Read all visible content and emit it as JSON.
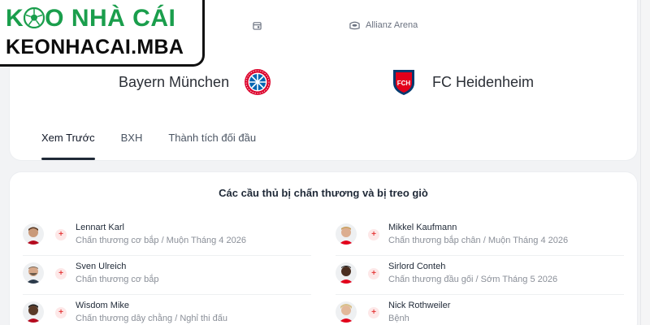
{
  "brand": {
    "line1_pre": "K",
    "line1_post": "O NHÀ CÁI",
    "line2": "KEONHACAI.MBA"
  },
  "match": {
    "venue": "Allianz Arena",
    "home_team": "Bayern München",
    "away_team": "FC Heidenheim",
    "home_crest_icon": "bayern-crest-icon",
    "away_crest_icon": "heidenheim-crest-icon"
  },
  "tabs": [
    {
      "label": "Xem Trước",
      "active": true
    },
    {
      "label": "BXH",
      "active": false
    },
    {
      "label": "Thành tích đối đầu",
      "active": false
    }
  ],
  "injuries": {
    "title": "Các cầu thủ bị chấn thương và bị treo giò",
    "home": [
      {
        "name": "Lennart Karl",
        "status": "Chấn thương cơ bắp / Muộn Tháng 4 2026"
      },
      {
        "name": "Sven Ulreich",
        "status": "Chấn thương cơ bắp"
      },
      {
        "name": "Wisdom Mike",
        "status": "Chấn thương dây chằng / Nghỉ thi đấu"
      }
    ],
    "away": [
      {
        "name": "Mikkel Kaufmann",
        "status": "Chấn thương bắp chân / Muộn Tháng 4 2026"
      },
      {
        "name": "Sirlord Conteh",
        "status": "Chấn thương đầu gối / Sớm Tháng 5 2026"
      },
      {
        "name": "Nick Rothweiler",
        "status": "Bệnh"
      }
    ]
  },
  "colors": {
    "brand_green": "#1a9e4c",
    "injury_red": "#e53e3e",
    "bayern_red": "#dc052d",
    "heidenheim_red": "#e2001a",
    "heidenheim_navy": "#003a70"
  }
}
